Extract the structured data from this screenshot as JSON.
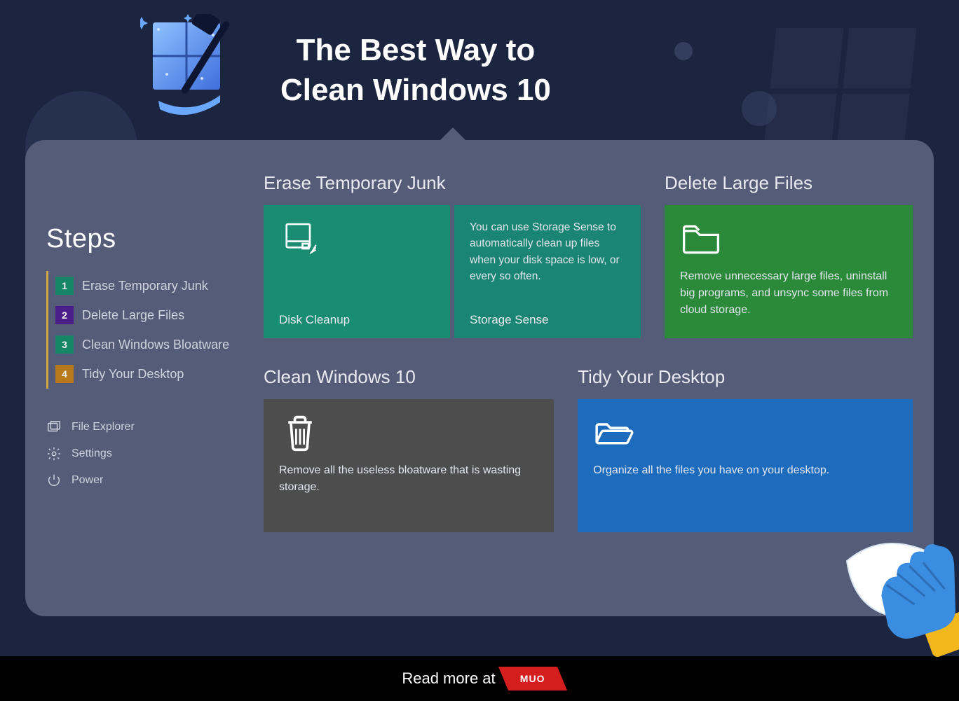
{
  "header": {
    "title_line1": "The Best Way to",
    "title_line2": "Clean Windows 10"
  },
  "sidebar": {
    "heading": "Steps",
    "steps": [
      {
        "num": "1",
        "label": "Erase Temporary Junk"
      },
      {
        "num": "2",
        "label": "Delete Large Files"
      },
      {
        "num": "3",
        "label": "Clean Windows Bloatware"
      },
      {
        "num": "4",
        "label": "Tidy Your Desktop"
      }
    ],
    "system": [
      {
        "label": "File Explorer"
      },
      {
        "label": "Settings"
      },
      {
        "label": "Power"
      }
    ]
  },
  "sections": {
    "erase": {
      "title": "Erase Temporary Junk",
      "disk_label": "Disk Cleanup",
      "sense_label": "Storage Sense",
      "sense_body": "You can use Storage Sense to automatically clean up files when your disk space is low, or every so often."
    },
    "large": {
      "title": "Delete Large Files",
      "body": "Remove unnecessary large files, uninstall big programs, and unsync some files from cloud storage."
    },
    "clean": {
      "title": "Clean Windows 10",
      "body": "Remove all the useless bloatware that is wasting storage."
    },
    "tidy": {
      "title": "Tidy Your Desktop",
      "body": "Organize all the files you have on your desktop."
    }
  },
  "footer": {
    "text": "Read more at",
    "badge": "MUO"
  }
}
